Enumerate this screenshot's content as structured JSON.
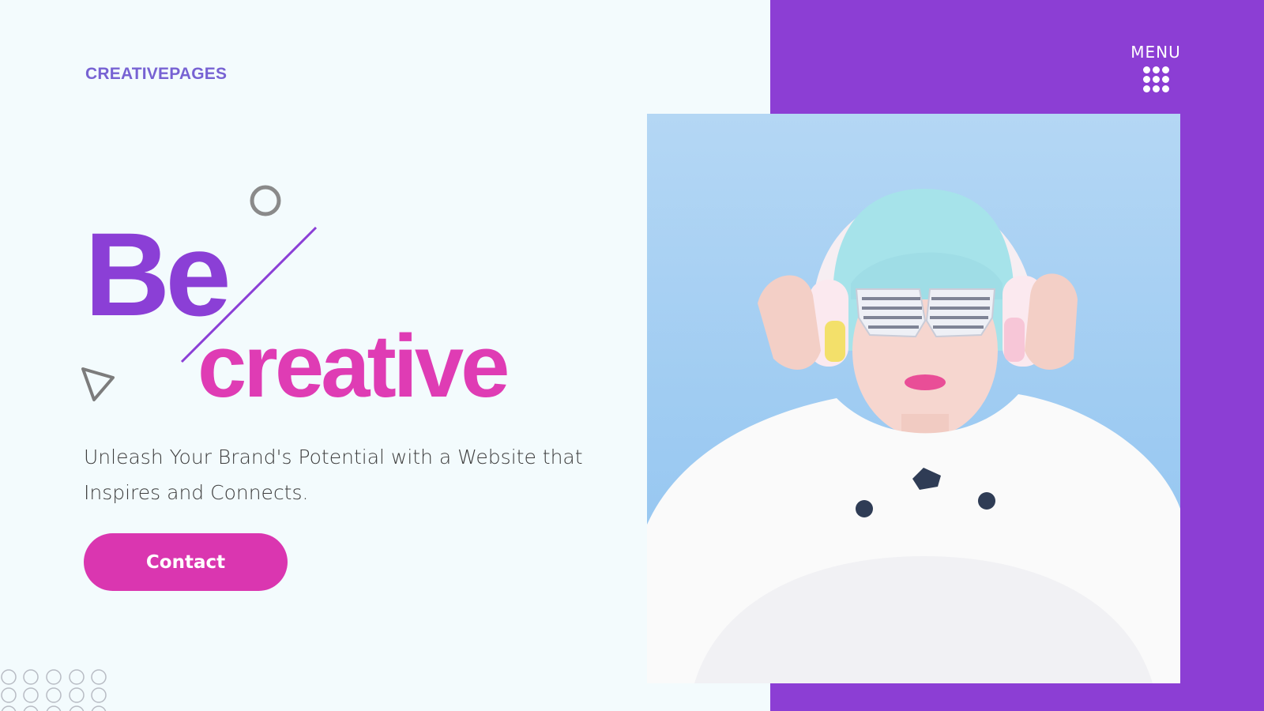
{
  "brand": {
    "logo_text": "CREATIVEPAGES"
  },
  "header": {
    "menu_label": "MENU"
  },
  "hero": {
    "title_line1": "Be",
    "title_line2": "creative",
    "subtitle_line1": "Unleash Your Brand's Potential with a Website that",
    "subtitle_line2": "Inspires and Connects.",
    "cta_label": "Contact"
  },
  "colors": {
    "accent_purple": "#8b3fd6",
    "accent_pink": "#df3cb4",
    "logo": "#7762d3",
    "background": "#f3fbfd"
  },
  "icons": {
    "menu": "grid-dots-icon",
    "circle_decor": "ring-icon",
    "triangle_decor": "triangle-outline-icon",
    "dot_pattern": "circle-pattern-icon"
  }
}
